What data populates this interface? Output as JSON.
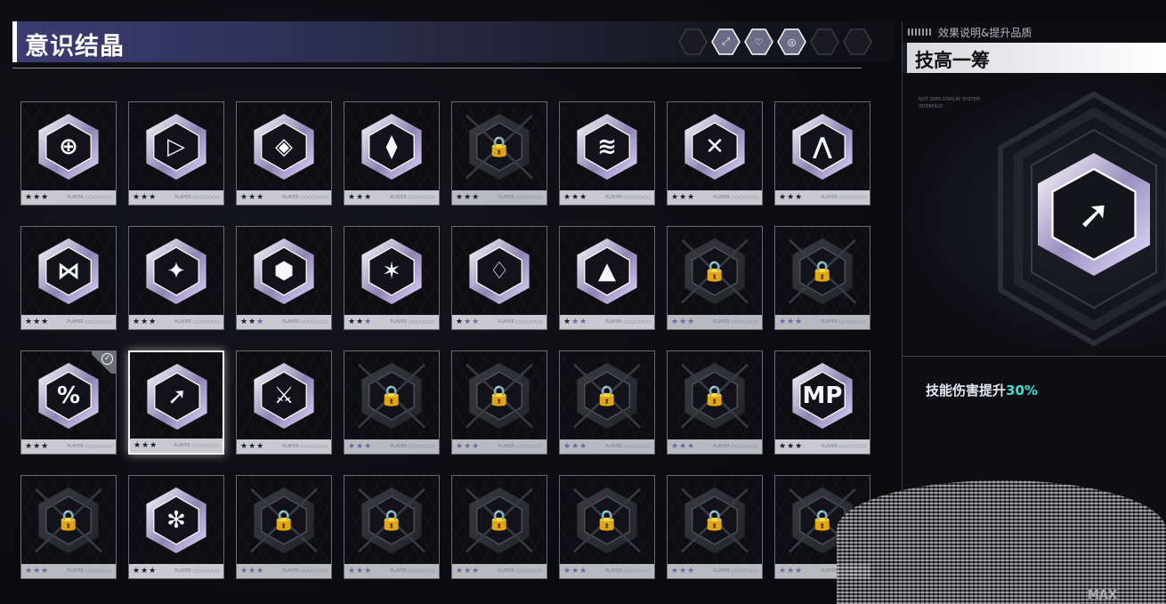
{
  "header": {
    "title": "意识结晶",
    "filters": [
      {
        "glyph": "",
        "active": false
      },
      {
        "glyph": "⤢",
        "active": true
      },
      {
        "glyph": "♡",
        "active": true
      },
      {
        "glyph": "◎",
        "active": true
      },
      {
        "glyph": "",
        "active": false
      },
      {
        "glyph": "",
        "active": false
      }
    ]
  },
  "card_tag": "PLAYER ○○○○○○○",
  "cards": [
    {
      "glyph": "⊕",
      "stars": 3,
      "locked": false
    },
    {
      "glyph": "▷",
      "stars": 3,
      "locked": false
    },
    {
      "glyph": "◈",
      "stars": 3,
      "locked": false
    },
    {
      "glyph": "⧫",
      "stars": 3,
      "locked": false
    },
    {
      "glyph": "🔒",
      "stars": 3,
      "locked": true
    },
    {
      "glyph": "≋",
      "stars": 3,
      "locked": false
    },
    {
      "glyph": "✕",
      "stars": 3,
      "locked": false
    },
    {
      "glyph": "⋀",
      "stars": 3,
      "locked": false
    },
    {
      "glyph": "⋈",
      "stars": 3,
      "locked": false
    },
    {
      "glyph": "✦",
      "stars": 3,
      "locked": false
    },
    {
      "glyph": "⬢",
      "stars": 2,
      "locked": false
    },
    {
      "glyph": "✶",
      "stars": 2,
      "locked": false
    },
    {
      "glyph": "♢",
      "stars": 1,
      "locked": false
    },
    {
      "glyph": "▲",
      "stars": 1,
      "locked": false
    },
    {
      "glyph": "🔒",
      "stars": 0,
      "locked": true
    },
    {
      "glyph": "🔒",
      "stars": 0,
      "locked": true
    },
    {
      "glyph": "%",
      "stars": 3,
      "locked": false,
      "equipped": true
    },
    {
      "glyph": "➚",
      "stars": 3,
      "locked": false,
      "selected": true
    },
    {
      "glyph": "⚔",
      "stars": 3,
      "locked": false
    },
    {
      "glyph": "🔒",
      "stars": 0,
      "locked": true
    },
    {
      "glyph": "🔒",
      "stars": 0,
      "locked": true
    },
    {
      "glyph": "🔒",
      "stars": 0,
      "locked": true
    },
    {
      "glyph": "🔒",
      "stars": 0,
      "locked": true
    },
    {
      "glyph": "MP",
      "stars": 3,
      "locked": false
    },
    {
      "glyph": "🔒",
      "stars": 0,
      "locked": true
    },
    {
      "glyph": "✻",
      "stars": 3,
      "locked": false
    },
    {
      "glyph": "🔒",
      "stars": 0,
      "locked": true
    },
    {
      "glyph": "🔒",
      "stars": 0,
      "locked": true
    },
    {
      "glyph": "🔒",
      "stars": 0,
      "locked": true
    },
    {
      "glyph": "🔒",
      "stars": 0,
      "locked": true
    },
    {
      "glyph": "🔒",
      "stars": 0,
      "locked": true
    },
    {
      "glyph": "🔒",
      "stars": 0,
      "locked": true
    }
  ],
  "panel": {
    "subtitle": "效果说明&提升品质",
    "name": "技高一筹",
    "tiny_code": "NOT DATA DISPLAY SYSTEM\nINTERFACE",
    "emblem_glyph": "➚",
    "effect_prefix": "技能伤害提升",
    "effect_value": "30%",
    "max_label": "MAX"
  },
  "colors": {
    "accent_highlight": "#3fe0d0",
    "title_gradient_start": "#3c3c74"
  }
}
